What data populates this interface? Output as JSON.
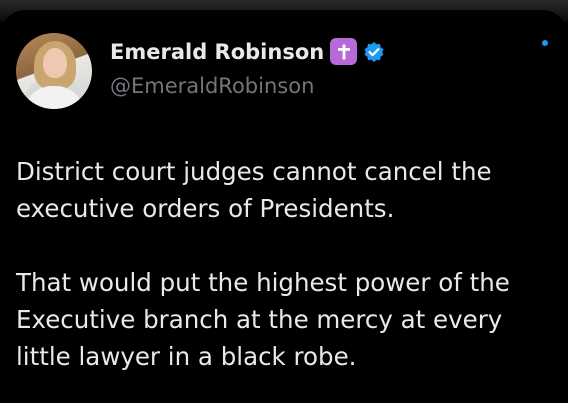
{
  "post": {
    "author": {
      "display_name": "Emerald Robinson",
      "handle": "@EmeraldRobinson",
      "badges": [
        "latin-cross-emoji",
        "verified-badge"
      ]
    },
    "body": [
      "District court judges cannot cancel the executive orders of Presidents.",
      "That would put the highest power of the Executive branch at the mercy at every little lawyer in a black robe."
    ]
  },
  "colors": {
    "background": "#000000",
    "text_primary": "#e7e9ea",
    "text_secondary": "#71767b",
    "verified": "#1d9bf0",
    "cross_badge": "#b56ad8"
  }
}
